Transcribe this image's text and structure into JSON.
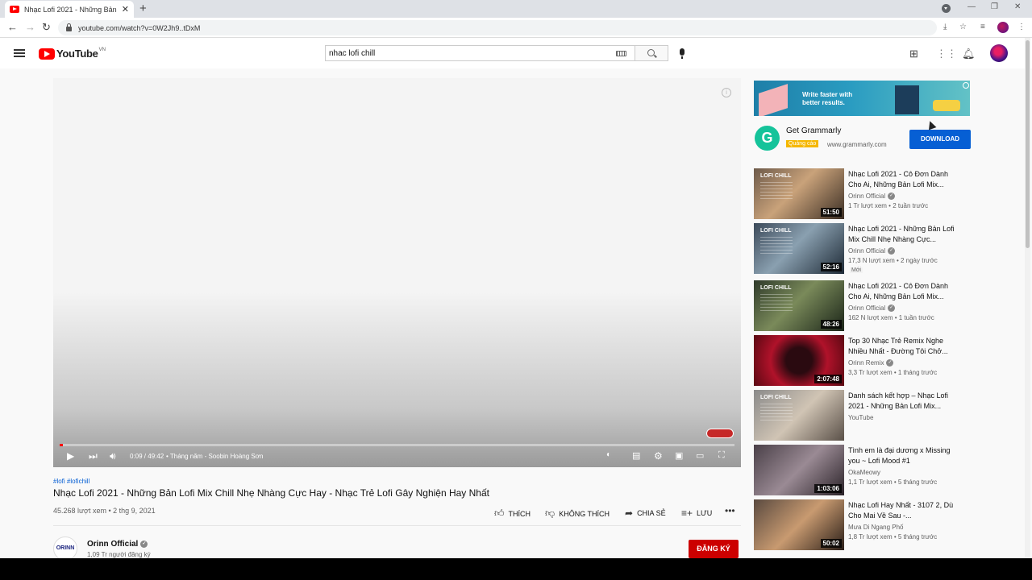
{
  "browser": {
    "tab_title": "Nhạc Lofi 2021 - Những Bản Lofi",
    "tab_close": "✕",
    "new_tab": "+",
    "url": "youtube.com/watch?v=0W2Jh9..tDxM",
    "icons": [
      "back-icon",
      "forward-icon",
      "reload-icon",
      "lock-icon",
      "download-icon",
      "bookmark-star-icon",
      "reading-list-icon",
      "menu-dots-icon"
    ]
  },
  "header": {
    "logo_text": "YouTube",
    "region": "VN",
    "search_value": "nhac lofi chill",
    "icons": [
      "hamburger-icon",
      "search-icon",
      "mic-icon",
      "create-video-icon",
      "apps-icon",
      "bell-icon"
    ]
  },
  "player": {
    "time": "0:09 / 49:42",
    "chapter": "• Tháng năm - Soobin Hoàng Sơn",
    "progress_fraction": 0.003
  },
  "video": {
    "hashtags": "#lofi #lofichill",
    "title": "Nhạc Lofi 2021 - Những Bản Lofi Mix Chill Nhẹ Nhàng Cực Hay - Nhạc Trẻ Lofi Gây Nghiện Hay Nhất",
    "meta": "45.268 lượt xem • 2 thg 9, 2021",
    "actions": {
      "like": "Thích",
      "dislike": "Không thích",
      "share": "Chia sẻ",
      "save": "Lưu",
      "more": "•••"
    }
  },
  "channel": {
    "avatar_text": "ORINN",
    "name": "Orinn Official",
    "subs": "1,09 Tr người đăng ký",
    "subscribe": "ĐĂNG KÝ"
  },
  "ad": {
    "banner_text": "Write faster with better results.",
    "logo_letter": "G",
    "name": "Get Grammarly",
    "badge": "Quảng cáo",
    "domain": "www.grammarly.com",
    "button": "DOWNLOAD",
    "accent": "#065fd4"
  },
  "recommendations": [
    {
      "title": "Nhạc Lofi 2021 - Cô Đơn Dành Cho Ai, Những Bản Lofi Mix...",
      "channel": "Orinn Official",
      "verified": true,
      "meta": "1 Tr lượt xem • 2 tuần trước",
      "duration": "51:50",
      "thumb_label": "LOFI CHILL",
      "new": ""
    },
    {
      "title": "Nhạc Lofi 2021 - Những Bản Lofi Mix Chill Nhẹ Nhàng Cực...",
      "channel": "Orinn Official",
      "verified": true,
      "meta": "17,3 N lượt xem • 2 ngày trước",
      "duration": "52:16",
      "thumb_label": "LOFI CHILL",
      "new": "Mới"
    },
    {
      "title": "Nhạc Lofi 2021 - Cô Đơn Dành Cho Ai, Những Bản Lofi Mix...",
      "channel": "Orinn Official",
      "verified": true,
      "meta": "162 N lượt xem • 1 tuần trước",
      "duration": "48:26",
      "thumb_label": "LOFI CHILL",
      "new": ""
    },
    {
      "title": "Top 30 Nhạc Trẻ Remix Nghe Nhiều Nhất - Đường Tôi Chở...",
      "channel": "Orinn Remix",
      "verified": true,
      "meta": "3,3 Tr lượt xem • 1 tháng trước",
      "duration": "2:07:48",
      "thumb_label": "",
      "new": ""
    },
    {
      "title": "Danh sách kết hợp – Nhạc Lofi 2021 - Những Bản Lofi Mix...",
      "channel": "YouTube",
      "verified": false,
      "meta": "",
      "duration": "",
      "thumb_label": "LOFI CHILL",
      "new": ""
    },
    {
      "title": "Tình em là đại dương x Missing you ~ Lofi Mood #1",
      "channel": "OkaMeowy",
      "verified": false,
      "meta": "1,1 Tr lượt xem • 5 tháng trước",
      "duration": "1:03:06",
      "thumb_label": "",
      "new": ""
    },
    {
      "title": "Nhạc Lofi Hay Nhất - 3107 2, Dù Cho Mai Về Sau -...",
      "channel": "Mưa Di Ngang Phố",
      "verified": false,
      "meta": "1,8 Tr lượt xem • 5 tháng trước",
      "duration": "50:02",
      "thumb_label": "",
      "new": ""
    }
  ]
}
